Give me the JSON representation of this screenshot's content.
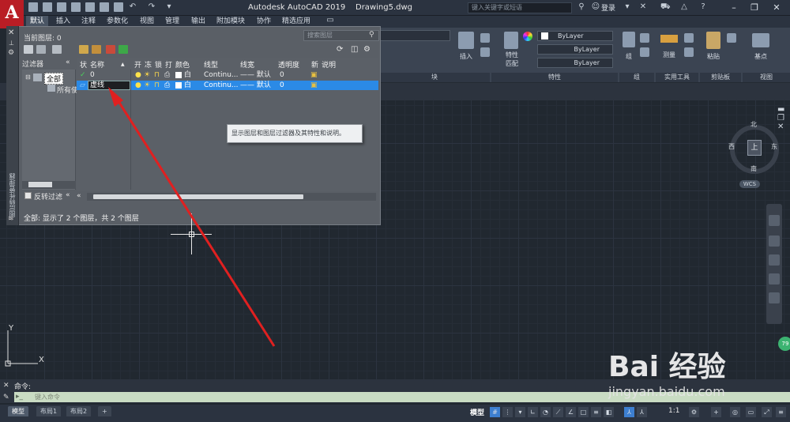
{
  "titlebar": {
    "app_title": "Autodesk AutoCAD 2019",
    "drawing_name": "Drawing5.dwg",
    "search_placeholder": "键入关键字或短语",
    "login_label": "登录"
  },
  "menu_tabs": [
    "默认",
    "插入",
    "注释",
    "参数化",
    "视图",
    "管理",
    "输出",
    "附加模块",
    "协作",
    "精选应用"
  ],
  "ribbon": {
    "insert_label": "插入",
    "block_panel": "块",
    "properties_btn": "特性",
    "match_btn": "匹配",
    "properties_panel": "特性",
    "bylayer_color": "ByLayer",
    "bylayer_linetype": "ByLayer",
    "bylayer_lineweight": "ByLayer",
    "group_btn": "组",
    "group_panel": "组",
    "measure_btn": "测量",
    "utilities_panel": "实用工具",
    "paste_btn": "粘贴",
    "clipboard_panel": "剪贴板",
    "base_btn": "基点",
    "view_panel": "视图"
  },
  "layer_palette": {
    "current_layer": "当前图层: 0",
    "search_placeholder": "搜索图层",
    "side_title": "图层特性管理器",
    "filters_header": "过滤器",
    "filter_tree": [
      "全部",
      "所有使"
    ],
    "invert_filter": "反转过滤",
    "columns": [
      "状",
      "名称",
      "开",
      "冻",
      "锁",
      "打",
      "颜色",
      "线型",
      "线宽",
      "透明度",
      "新",
      "说明"
    ],
    "rows": [
      {
        "name": "0",
        "color": "白",
        "linetype": "Continu...",
        "lineweight": "—— 默认",
        "transparency": "0",
        "selected": false
      },
      {
        "name": "虚线",
        "color": "白",
        "linetype": "Continu...",
        "lineweight": "—— 默认",
        "transparency": "0",
        "selected": true
      }
    ],
    "status": "全部: 显示了 2 个图层，共 2 个图层",
    "tooltip": "显示图层和图层过滤器及其特性和说明。"
  },
  "viewcube": {
    "north": "北",
    "south": "南",
    "east": "东",
    "west": "西",
    "top": "上",
    "wcs": "WCS"
  },
  "ucs": {
    "x": "X",
    "y": "Y"
  },
  "command": {
    "history": "命令:",
    "placeholder": "键入命令"
  },
  "layout_tabs": [
    "模型",
    "布局1",
    "布局2"
  ],
  "statusbar": {
    "model_label": "模型",
    "scale": "1:1"
  },
  "badge": "79",
  "watermark": {
    "brand": "Bai 经验",
    "url": "jingyan.baidu.com"
  },
  "colors": {
    "selected_row": "#2b8ae6",
    "arrow": "#e02020",
    "logo_red": "#b91d25"
  }
}
